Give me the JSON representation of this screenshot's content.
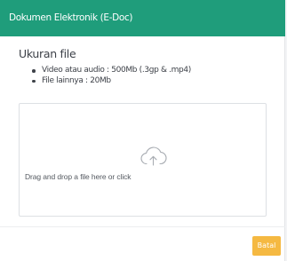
{
  "modal": {
    "title": "Dokumen Elektronik (E-Doc)"
  },
  "file_size": {
    "heading": "Ukuran file",
    "items": [
      "Video atau audio : 500Mb (.3gp & .mp4)",
      "File lainnya : 20Mb"
    ]
  },
  "dropzone": {
    "icon": "cloud-upload-icon",
    "message": "Drag and drop a file here or click"
  },
  "footer": {
    "cancel_label": "Batal"
  },
  "colors": {
    "header_bg": "#1f9d7b",
    "cancel_button_bg": "#f5b942"
  }
}
